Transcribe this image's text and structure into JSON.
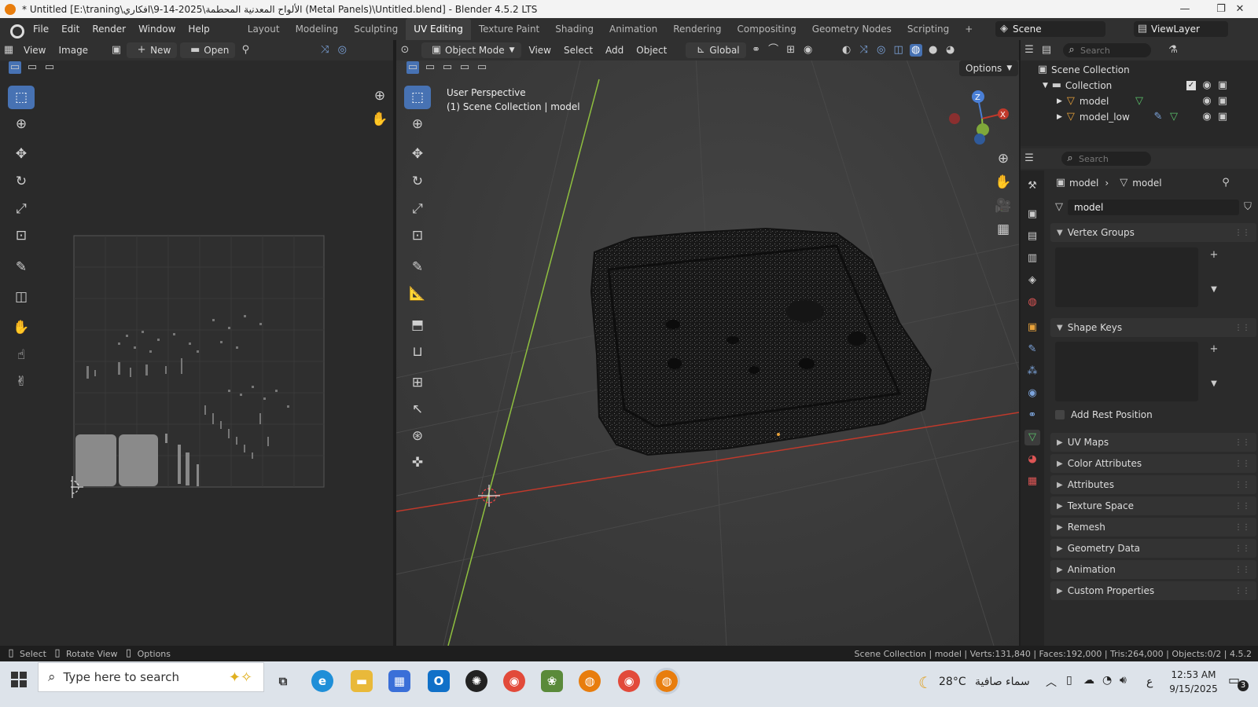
{
  "window": {
    "title": "* Untitled [E:\\traning\\الألواح المعدنية المحطمة\\2025-14-9\\افكاري (Metal Panels)\\Untitled.blend] - Blender 4.5.2 LTS",
    "minimize": "—",
    "maximize": "❐",
    "close": "✕"
  },
  "menu": {
    "items": [
      "File",
      "Edit",
      "Render",
      "Window",
      "Help"
    ]
  },
  "workspaces": [
    "Layout",
    "Modeling",
    "Sculpting",
    "UV Editing",
    "Texture Paint",
    "Shading",
    "Animation",
    "Rendering",
    "Compositing",
    "Geometry Nodes",
    "Scripting"
  ],
  "active_workspace": "UV Editing",
  "add_workspace": "+",
  "scene": {
    "label": "Scene",
    "viewlayer": "ViewLayer"
  },
  "uv_editor": {
    "view": "View",
    "image": "Image",
    "new": "New",
    "open": "Open"
  },
  "viewport": {
    "mode": "Object Mode",
    "view": "View",
    "select": "Select",
    "add": "Add",
    "object": "Object",
    "orientation": "Global",
    "options": "Options",
    "perspective": "User Perspective",
    "collection_info": "(1) Scene Collection | model",
    "gizmo_z": "Z",
    "gizmo_x": "X"
  },
  "outliner": {
    "search_placeholder": "Search",
    "scene_collection": "Scene Collection",
    "collection": "Collection",
    "objects": [
      "model",
      "model_low"
    ]
  },
  "properties": {
    "search_placeholder": "Search",
    "breadcrumb_object": "model",
    "breadcrumb_mesh": "model",
    "mesh_name": "model",
    "vertex_groups": "Vertex Groups",
    "shape_keys": "Shape Keys",
    "add_rest_position": "Add Rest Position",
    "sections": [
      "UV Maps",
      "Color Attributes",
      "Attributes",
      "Texture Space",
      "Remesh",
      "Geometry Data",
      "Animation",
      "Custom Properties"
    ]
  },
  "statusbar": {
    "select": "Select",
    "rotate_view": "Rotate View",
    "options": "Options",
    "stats": "Scene Collection | model | Verts:131,840 | Faces:192,000 | Tris:264,000 | Objects:0/2 | 4.5.2"
  },
  "taskbar": {
    "search_placeholder": "Type here to search",
    "weather_temp": "28°C",
    "weather_text": "سماء صافية",
    "lang": "ع",
    "time": "12:53 AM",
    "date": "9/15/2025",
    "notifications": "3"
  },
  "colors": {
    "accent": "#4772b3",
    "orange": "#e87d0d",
    "x_axis": "#c0392b",
    "y_axis": "#8fbf3f"
  }
}
